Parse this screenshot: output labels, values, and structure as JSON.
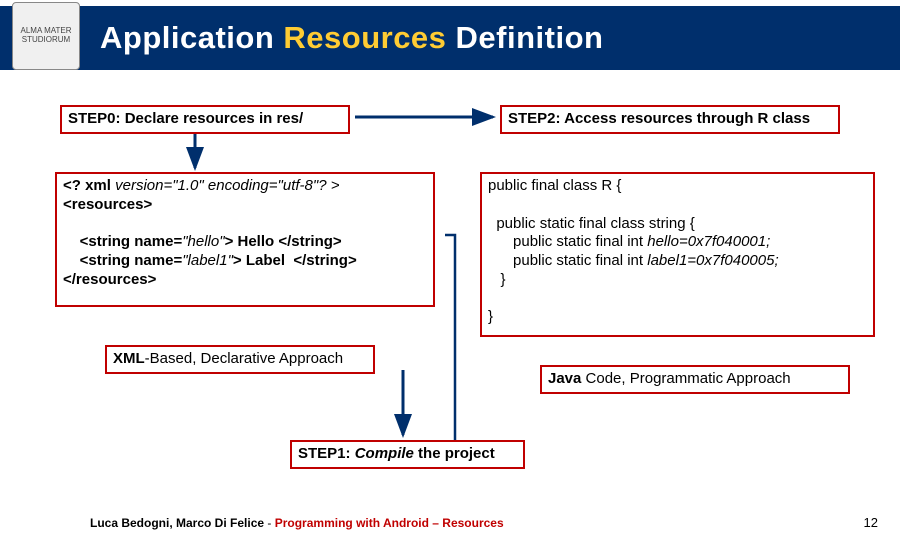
{
  "title": {
    "part1": "Application ",
    "accent": "Resources",
    "part2": " Definition"
  },
  "seal": "ALMA MATER STUDIORUM",
  "step0": {
    "label": "STEP0",
    "desc": ": Declare resources in res/"
  },
  "step2": {
    "label": "STEP2",
    "desc": ": Access resources through R class"
  },
  "step1": {
    "label": "STEP1",
    "desc_prefix": ": ",
    "desc_italic": "Compile",
    "desc_suffix": " the project"
  },
  "xml": {
    "l1a": "<? xml ",
    "l1b": "version=\"1.0\" encoding=\"utf-8\"? >",
    "l2": "<resources>",
    "l3a": "    <string name=",
    "l3b": "\"hello\"",
    "l3c": "> Hello </string>",
    "l4a": "    <string name=",
    "l4b": "\"label1\"",
    "l4c": "> Label  </string>",
    "l5": "</resources>"
  },
  "java": {
    "l1": "public final class R {",
    "l2": "  public static final class string {",
    "l3a": "      public static final int ",
    "l3b": "hello=0x7f040001;",
    "l4a": "      public static final int ",
    "l4b": "label1=0x7f040005;",
    "l5": "   }",
    "l6": "}"
  },
  "approach": {
    "xml_bold": "XML",
    "xml_rest": "-Based, Declarative Approach",
    "java_bold": "Java",
    "java_rest": " Code, Programmatic Approach"
  },
  "footer": {
    "authors": "Luca Bedogni, Marco Di Felice",
    "sep": " - ",
    "course": "Programming with Android – Resources"
  },
  "page": "12"
}
